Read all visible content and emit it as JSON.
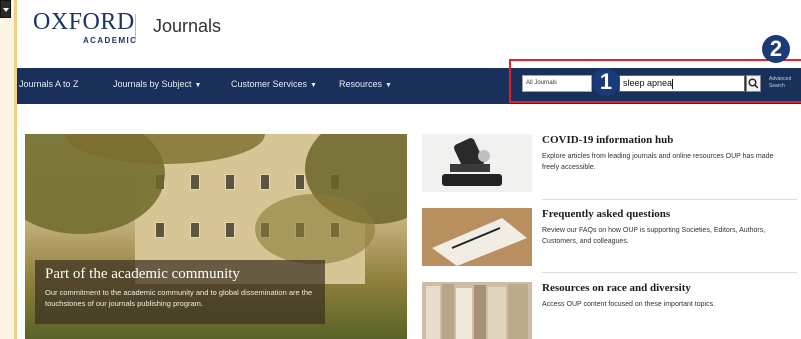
{
  "header": {
    "logo_main": "OXFORD",
    "logo_sub": "ACADEMIC",
    "site_title": "Journals"
  },
  "nav": {
    "items": [
      {
        "label": "Journals A to Z",
        "has_caret": false
      },
      {
        "label": "Journals by Subject",
        "has_caret": true
      },
      {
        "label": "Customer Services",
        "has_caret": true
      },
      {
        "label": "Resources",
        "has_caret": true
      }
    ],
    "caret_glyph": "▼"
  },
  "search": {
    "scope_value": "All Journals",
    "query_value": "sleep apnea",
    "advanced_line1": "Advanced",
    "advanced_line2": "Search"
  },
  "annotations": {
    "badge1": "1",
    "badge2": "2"
  },
  "hero": {
    "title": "Part of the academic community",
    "text": "Our commitment to the academic community and to global dissemination are the touchstones of our journals publishing program."
  },
  "promos": [
    {
      "title": "COVID-19 information hub",
      "desc": "Explore articles from leading journals and online resources OUP has made freely accessible."
    },
    {
      "title": "Frequently asked questions",
      "desc": "Review our FAQs on how OUP is supporting Societies, Editors, Authors, Customers, and colleagues."
    },
    {
      "title": "Resources on race and diversity",
      "desc": "Access OUP content focused on these important topics."
    }
  ],
  "colors": {
    "nav_bg": "#18305a",
    "logo": "#1c3565",
    "highlight_border": "#e2222a",
    "badge": "#1b3a78"
  }
}
